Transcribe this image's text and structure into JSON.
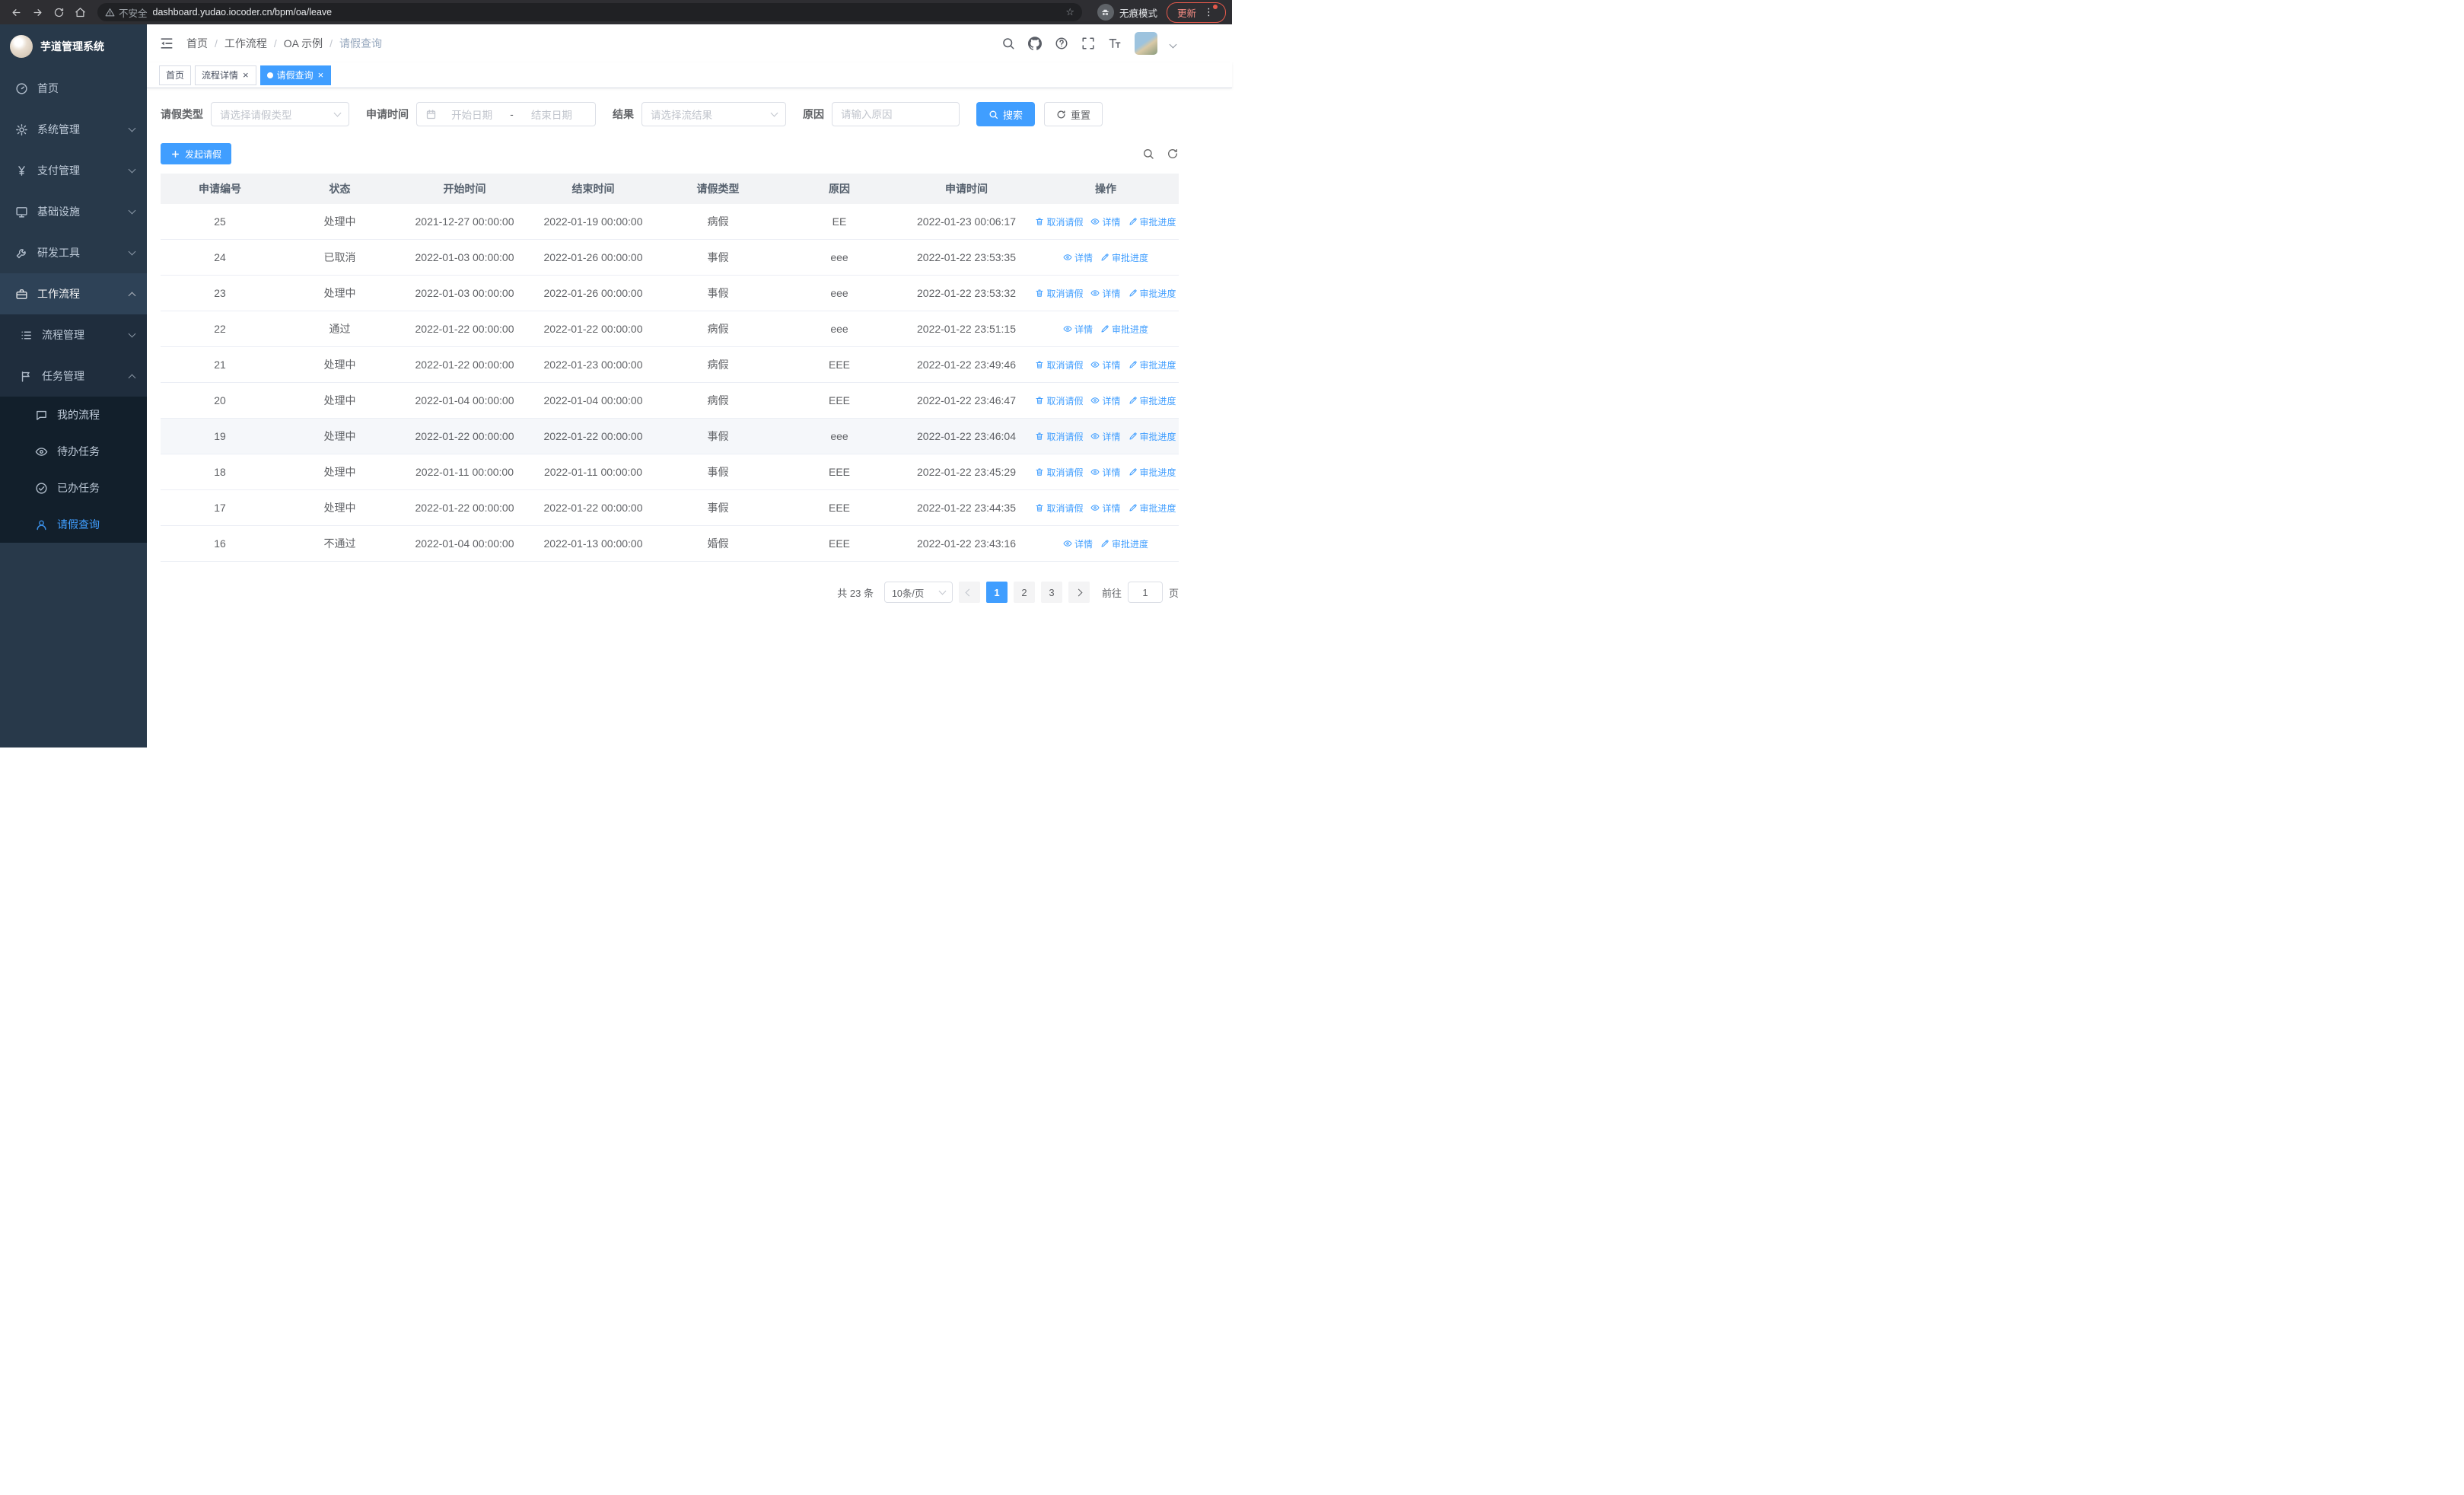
{
  "theme": {
    "primary": "#409eff",
    "sidebar_bg": "#28394a",
    "tag_active": "#409eff"
  },
  "browser": {
    "security_label": "不安全",
    "url": "dashboard.yudao.iocoder.cn/bpm/oa/leave",
    "incognito_label": "无痕模式",
    "update_label": "更新"
  },
  "glyphs": {
    "close": "×",
    "more": "⋮",
    "star": "☆"
  },
  "sidebar": {
    "logo_title": "芋道管理系统",
    "items": [
      {
        "label": "首页"
      },
      {
        "label": "系统管理"
      },
      {
        "label": "支付管理"
      },
      {
        "label": "基础设施"
      },
      {
        "label": "研发工具"
      },
      {
        "label": "工作流程"
      }
    ],
    "sub_items": [
      {
        "label": "流程管理"
      },
      {
        "label": "任务管理"
      }
    ],
    "leaf_items": [
      {
        "label": "我的流程"
      },
      {
        "label": "待办任务"
      },
      {
        "label": "已办任务"
      },
      {
        "label": "请假查询"
      }
    ]
  },
  "header": {
    "breadcrumb": [
      "首页",
      "工作流程",
      "OA 示例",
      "请假查询"
    ],
    "separator": "/"
  },
  "tabs": [
    {
      "label": "首页"
    },
    {
      "label": "流程详情"
    },
    {
      "label": "请假查询"
    }
  ],
  "filters": {
    "type_label": "请假类型",
    "type_placeholder": "请选择请假类型",
    "time_label": "申请时间",
    "start_placeholder": "开始日期",
    "range_separator": "-",
    "end_placeholder": "结束日期",
    "result_label": "结果",
    "result_placeholder": "请选择流结果",
    "reason_label": "原因",
    "reason_placeholder": "请输入原因",
    "search_label": "搜索",
    "reset_label": "重置"
  },
  "toolbar": {
    "create_label": "发起请假"
  },
  "table": {
    "columns": [
      "申请编号",
      "状态",
      "开始时间",
      "结束时间",
      "请假类型",
      "原因",
      "申请时间",
      "操作"
    ],
    "actions": {
      "cancel": "取消请假",
      "detail": "详情",
      "progress": "审批进度"
    },
    "rows": [
      {
        "id": "25",
        "status": "处理中",
        "start": "2021-12-27 00:00:00",
        "end": "2022-01-19 00:00:00",
        "type": "病假",
        "reason": "EE",
        "applied": "2022-01-23 00:06:17",
        "cancellable": true,
        "highlight": false
      },
      {
        "id": "24",
        "status": "已取消",
        "start": "2022-01-03 00:00:00",
        "end": "2022-01-26 00:00:00",
        "type": "事假",
        "reason": "eee",
        "applied": "2022-01-22 23:53:35",
        "cancellable": false,
        "highlight": false
      },
      {
        "id": "23",
        "status": "处理中",
        "start": "2022-01-03 00:00:00",
        "end": "2022-01-26 00:00:00",
        "type": "事假",
        "reason": "eee",
        "applied": "2022-01-22 23:53:32",
        "cancellable": true,
        "highlight": false
      },
      {
        "id": "22",
        "status": "通过",
        "start": "2022-01-22 00:00:00",
        "end": "2022-01-22 00:00:00",
        "type": "病假",
        "reason": "eee",
        "applied": "2022-01-22 23:51:15",
        "cancellable": false,
        "highlight": false
      },
      {
        "id": "21",
        "status": "处理中",
        "start": "2022-01-22 00:00:00",
        "end": "2022-01-23 00:00:00",
        "type": "病假",
        "reason": "EEE",
        "applied": "2022-01-22 23:49:46",
        "cancellable": true,
        "highlight": false
      },
      {
        "id": "20",
        "status": "处理中",
        "start": "2022-01-04 00:00:00",
        "end": "2022-01-04 00:00:00",
        "type": "病假",
        "reason": "EEE",
        "applied": "2022-01-22 23:46:47",
        "cancellable": true,
        "highlight": false
      },
      {
        "id": "19",
        "status": "处理中",
        "start": "2022-01-22 00:00:00",
        "end": "2022-01-22 00:00:00",
        "type": "事假",
        "reason": "eee",
        "applied": "2022-01-22 23:46:04",
        "cancellable": true,
        "highlight": true
      },
      {
        "id": "18",
        "status": "处理中",
        "start": "2022-01-11 00:00:00",
        "end": "2022-01-11 00:00:00",
        "type": "事假",
        "reason": "EEE",
        "applied": "2022-01-22 23:45:29",
        "cancellable": true,
        "highlight": false
      },
      {
        "id": "17",
        "status": "处理中",
        "start": "2022-01-22 00:00:00",
        "end": "2022-01-22 00:00:00",
        "type": "事假",
        "reason": "EEE",
        "applied": "2022-01-22 23:44:35",
        "cancellable": true,
        "highlight": false
      },
      {
        "id": "16",
        "status": "不通过",
        "start": "2022-01-04 00:00:00",
        "end": "2022-01-13 00:00:00",
        "type": "婚假",
        "reason": "EEE",
        "applied": "2022-01-22 23:43:16",
        "cancellable": false,
        "highlight": false
      }
    ]
  },
  "pagination": {
    "total_text": "共 23 条",
    "page_size": "10条/页",
    "pages": [
      "1",
      "2",
      "3"
    ],
    "active_page": "1",
    "goto_label": "前往",
    "goto_value": "1",
    "unit_label": "页"
  }
}
